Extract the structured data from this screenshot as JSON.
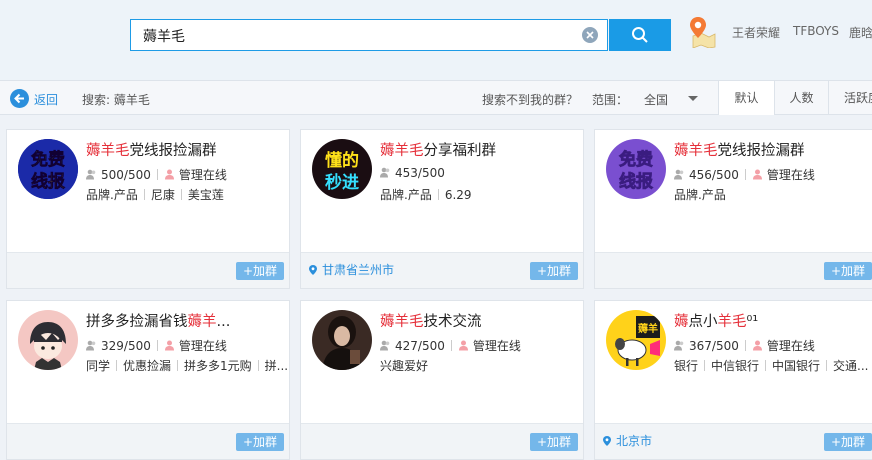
{
  "search": {
    "query": "薅羊毛"
  },
  "hot_links": [
    "王者荣耀",
    "TFBOYS",
    "鹿晗"
  ],
  "filter": {
    "back_label": "返回",
    "search_prefix": "搜索: 薅羊毛",
    "not_found": "搜索不到我的群？",
    "range_label": "范围：",
    "range_value": "全国",
    "sort_tabs": [
      "默认",
      "人数",
      "活跃度"
    ]
  },
  "join_label": "+加群",
  "cards": [
    {
      "title_hl": "薅羊毛",
      "title_rest": "党线报捡漏群",
      "members": "500/500",
      "admin": "管理在线",
      "tags": [
        "品牌.产品",
        "尼康",
        "美宝莲"
      ],
      "location": ""
    },
    {
      "title_hl": "薅羊毛",
      "title_rest": "分享福利群",
      "members": "453/500",
      "admin": "",
      "tags": [
        "品牌.产品",
        "6.29"
      ],
      "location": "甘肃省兰州市"
    },
    {
      "title_hl": "薅羊毛",
      "title_rest": "党线报捡漏群",
      "members": "456/500",
      "admin": "管理在线",
      "tags": [
        "品牌.产品"
      ],
      "location": ""
    },
    {
      "title_pre": "拼多多捡漏省钱",
      "title_hl": "薅羊",
      "title_rest": "...",
      "members": "329/500",
      "admin": "管理在线",
      "tags": [
        "同学",
        "优惠捡漏",
        "拼多多1元购",
        "拼..."
      ],
      "location": ""
    },
    {
      "title_hl": "薅羊毛",
      "title_rest": "技术交流",
      "members": "427/500",
      "admin": "管理在线",
      "tags": [
        "兴趣爱好"
      ],
      "location": ""
    },
    {
      "title_hl": "薅",
      "title_mid": "点小",
      "title_hl2": "羊毛",
      "title_rest": "⁰¹",
      "members": "367/500",
      "admin": "管理在线",
      "tags": [
        "银行",
        "中信银行",
        "中国银行",
        "交通..."
      ],
      "location": "北京市"
    }
  ],
  "avatars": [
    {
      "line1": "免费",
      "line2": "线报"
    },
    {
      "line1": "懂的",
      "line2": "秒进"
    },
    {
      "line1": "免费",
      "line2": "线报"
    },
    {
      "icon": "cartoon-boy-icon"
    },
    {
      "icon": "girl-photo-icon"
    },
    {
      "icon": "sheep-icon",
      "text": "薅羊"
    }
  ],
  "colors": {
    "accent": "#1a9be6",
    "highlight": "#e5303a",
    "join_btn": "#74b7ea",
    "link": "#2b8fdc"
  }
}
